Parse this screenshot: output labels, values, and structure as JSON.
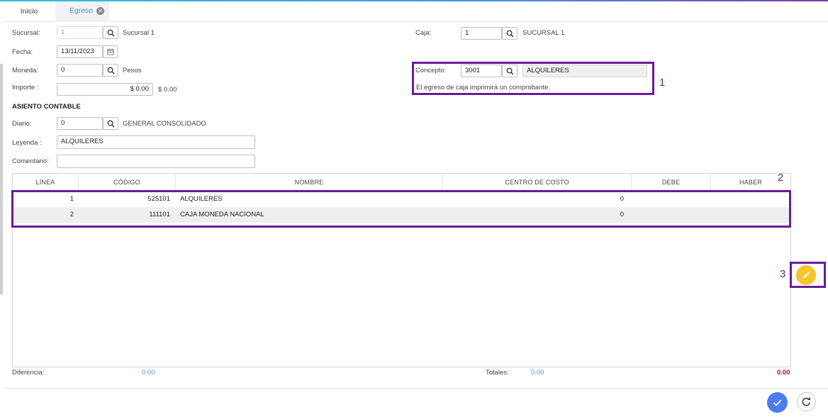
{
  "tabs": [
    {
      "label": "Inicio"
    },
    {
      "label": "Egreso"
    }
  ],
  "form": {
    "sucursal": {
      "label": "Sucursal:",
      "value": "1",
      "name": "Sucursal 1"
    },
    "fecha": {
      "label": "Fecha:",
      "value": "13/11/2023"
    },
    "moneda": {
      "label": "Moneda:",
      "value": "0",
      "name": "Pesos"
    },
    "importe": {
      "label": "Importe :",
      "value": "$ 0.00",
      "display": "$ 0.00"
    },
    "caja": {
      "label": "Caja:",
      "value": "1",
      "name": "SUCURSAL 1"
    },
    "concepto": {
      "label": "Concepto:",
      "value": "3001",
      "name": "ALQUILERES",
      "note": "El egreso de caja imprimirá un comprobante."
    }
  },
  "asiento": {
    "title": "ASIENTO CONTABLE",
    "diario": {
      "label": "Diario:",
      "value": "0",
      "name": "GENERAL CONSOLIDADO"
    },
    "leyenda": {
      "label": "Leyenda :",
      "value": "ALQUILERES"
    },
    "comentario": {
      "label": "Comentario:",
      "value": ""
    }
  },
  "table": {
    "columns": [
      "LÍNEA",
      "CÓDIGO",
      "NOMBRE",
      "CENTRO DE COSTO",
      "DEBE",
      "HABER"
    ],
    "rows": [
      {
        "linea": "1",
        "codigo": "525101",
        "nombre": "ALQUILERES",
        "centro": "0",
        "debe": "",
        "haber": ""
      },
      {
        "linea": "2",
        "codigo": "111101",
        "nombre": "CAJA MONEDA NACIONAL",
        "centro": "0",
        "debe": "",
        "haber": ""
      }
    ]
  },
  "totals": {
    "diferencia_label": "Diferencia:",
    "diferencia_value": "0.00",
    "totales_label": "Totales:",
    "totales_debe": "0.00",
    "totales_haber": "0.00"
  },
  "annotations": [
    "1",
    "2",
    "3"
  ],
  "icons": {
    "search": "search-icon",
    "calendar": "calendar-icon",
    "edit": "pencil-icon",
    "confirm": "check-icon",
    "reload": "refresh-icon",
    "close": "close-icon"
  },
  "colors": {
    "accent": "#4a90e2",
    "highlight": "#6a1b9a",
    "fab": "#f7c52c",
    "confirm": "#4a7cf0",
    "negative": "#d0021b"
  }
}
